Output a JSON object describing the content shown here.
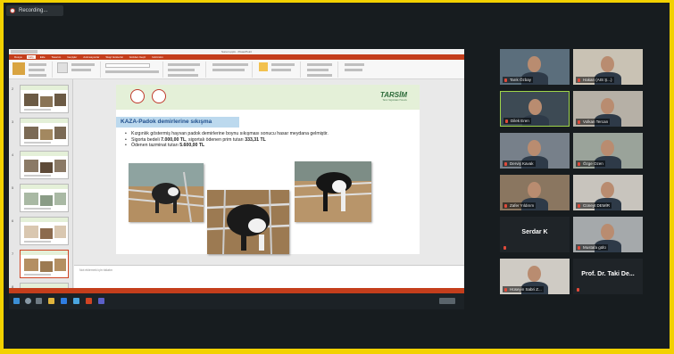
{
  "recording": {
    "label": "Recording..."
  },
  "presentation": {
    "app_title": "Sunum.pptx - PowerPoint",
    "ribbon_tabs": [
      "Dosya",
      "Giriş",
      "Ekle",
      "Tasarım",
      "Geçişler",
      "Animasyonlar",
      "Slayt Gösterisi",
      "Gözden Geçir",
      "Görünüm"
    ],
    "active_tab_index": 1,
    "slide_numbers": [
      "2",
      "3",
      "4",
      "5",
      "6",
      "7",
      "8"
    ],
    "selected_slide_index": 5,
    "notes_placeholder": "Not eklemek için tıklatın",
    "slide": {
      "logo": "TARSİM",
      "logo_sub": "Tarım Sigortaları Havuzu",
      "title": "KAZA-Padok demirlerine sıkışma",
      "bullets": [
        {
          "text": "Kızgınlık göstermiş hayvan padok demirlerine boynu sıkışması sonucu hasar meydana gelmiştir."
        },
        {
          "text": "Sigorta bedeli ",
          "bold": "7.000,00 TL",
          "text2": ", sigortalı ödenen prim tutarı ",
          "bold2": "333,31 TL"
        },
        {
          "text": "Ödenen tazminat tutarı ",
          "bold": "5.600,00 TL"
        }
      ]
    }
  },
  "participants": [
    {
      "name": "Tarık Özbay"
    },
    {
      "name": "Hakan (AIS Ş...)"
    },
    {
      "name": "Dilek Eren"
    },
    {
      "name": "Volkan Tercan"
    },
    {
      "name": "Derviş Kavak"
    },
    {
      "name": "Özge Ozen"
    },
    {
      "name": "Zafer Yıldırım"
    },
    {
      "name": "Cüneyt DEMİR"
    },
    {
      "name": "Serdar K"
    },
    {
      "name": "Mustafa gülü"
    },
    {
      "name": "Hüseyin Sabri Z..."
    },
    {
      "name": "Prof. Dr. Taki De..."
    }
  ]
}
